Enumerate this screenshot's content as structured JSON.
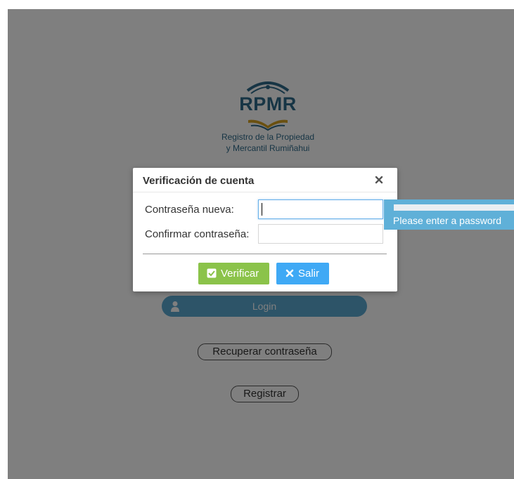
{
  "logo": {
    "title": "RPMR",
    "subtitle_line1": "Registro de la Propiedad",
    "subtitle_line2": "y Mercantil Rumiñahui",
    "brand_color": "#2f6b8a",
    "accent_color": "#d5a021"
  },
  "background_page": {
    "login_label": "Login",
    "recover_label": "Recuperar contraseña",
    "register_label": "Registrar"
  },
  "dialog": {
    "title": "Verificación de cuenta",
    "close_icon": "close-icon",
    "new_password_label": "Contraseña nueva:",
    "new_password_value": "",
    "confirm_password_label": "Confirmar contraseña:",
    "confirm_password_value": "",
    "verify_label": "Verificar",
    "exit_label": "Salir",
    "verify_color": "#8bc34a",
    "exit_color": "#3fa9f5"
  },
  "validation_tooltip": {
    "message": "Please enter a password"
  }
}
